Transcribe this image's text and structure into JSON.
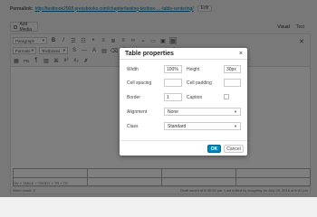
{
  "permalink": {
    "label": "Permalink:",
    "url": "http://testbook2008.pressbooks.com/chapter/testing-textbox-…-table-centering/",
    "edit_label": "Edit"
  },
  "media": {
    "add_label": "Add Media"
  },
  "editor_modes": {
    "visual": "Visual",
    "text": "Text"
  },
  "toolbar": {
    "row1": {
      "format_select": "Paragraph",
      "bold": "B",
      "italic": "I"
    },
    "row2": {
      "formats_select": "Formats",
      "textboxes_select": "Textboxes"
    },
    "row3": {
      "pn": "PN"
    }
  },
  "editor": {
    "path": "DIV » TABLE » TBODY » TR » TD"
  },
  "status": {
    "word_count": "Word count: 0",
    "draft_saved": "Draft saved at 6:40:25 pm. Last edited by xnuyetay on July 29, 2016 at 6:41 pm"
  },
  "dialog": {
    "title": "Table properties",
    "close_glyph": "×",
    "width_label": "Width",
    "width_value": "100%",
    "height_label": "Height",
    "height_value": "30px",
    "cell_spacing_label": "Cell spacing",
    "cell_spacing_value": "",
    "cell_padding_label": "Cell padding",
    "cell_padding_value": "",
    "border_label": "Border",
    "border_value": "1",
    "caption_label": "Caption",
    "caption_checked": false,
    "alignment_label": "Alignment",
    "alignment_value": "None",
    "class_label": "Class",
    "class_value": "Standard",
    "ok_label": "OK",
    "cancel_label": "Cancel"
  },
  "colors": {
    "primary": "#0085ba",
    "overlay": "#000000"
  }
}
